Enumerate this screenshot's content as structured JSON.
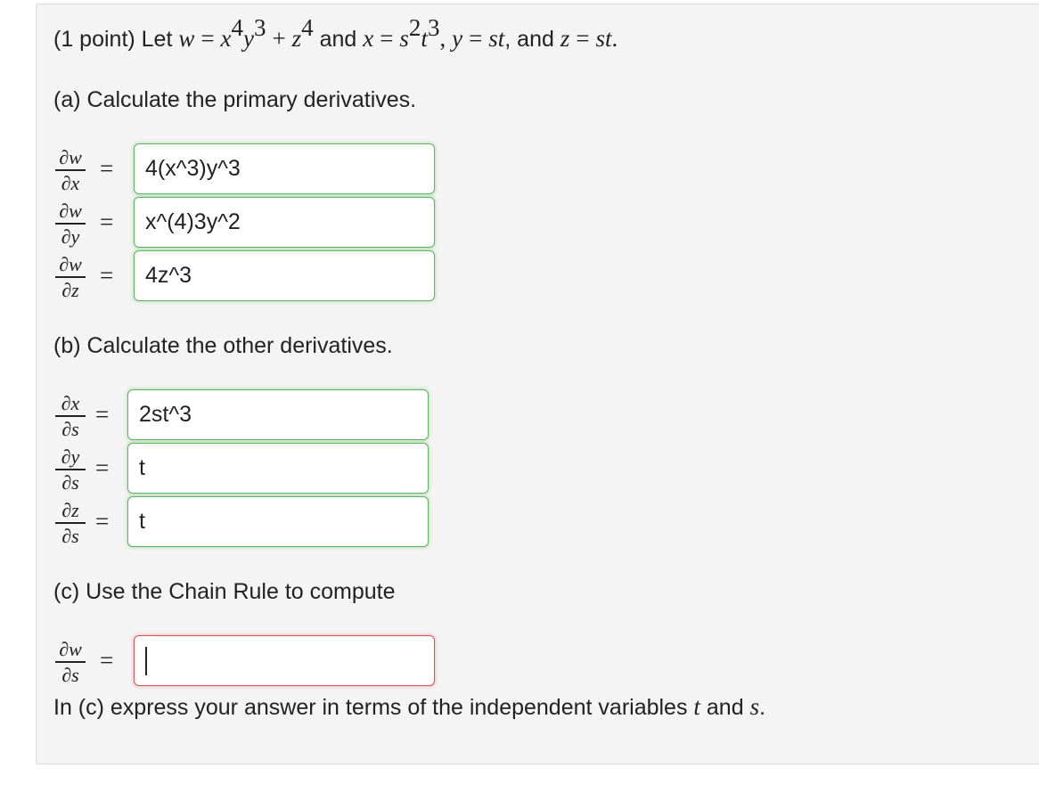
{
  "intro": {
    "points": "(1 point) Let",
    "w": "w",
    "eq": "=",
    "x": "x",
    "exp4": "4",
    "y": "y",
    "exp3": "3",
    "plus": "+",
    "z": "z",
    "zexp": "4",
    "and": "and",
    "x2": "x",
    "s": "s",
    "sexp": "2",
    "t": "t",
    "texp": "3",
    "comma": ",",
    "y2": "y",
    "st": "st",
    "and2": ", and",
    "z2": "z",
    "st2": "st",
    "period": "."
  },
  "part_a": {
    "heading": "(a) Calculate the primary derivatives.",
    "rows": [
      {
        "num": "∂w",
        "den": "∂x",
        "eq": "=",
        "value": "4(x^3)y^3"
      },
      {
        "num": "∂w",
        "den": "∂y",
        "eq": "=",
        "value": "x^(4)3y^2"
      },
      {
        "num": "∂w",
        "den": "∂z",
        "eq": "=",
        "value": "4z^3"
      }
    ]
  },
  "part_b": {
    "heading": "(b) Calculate the other derivatives.",
    "rows": [
      {
        "num": "∂x",
        "den": "∂s",
        "eq": "=",
        "value": "2st^3"
      },
      {
        "num": "∂y",
        "den": "∂s",
        "eq": "=",
        "value": "t"
      },
      {
        "num": "∂z",
        "den": "∂s",
        "eq": "=",
        "value": "t"
      }
    ]
  },
  "part_c": {
    "heading": "(c) Use the Chain Rule to compute",
    "row": {
      "num": "∂w",
      "den": "∂s",
      "eq": "=",
      "value": ""
    },
    "note_prefix": "In (c) express your answer in terms of the independent variables",
    "note_t": "t",
    "note_and": "and",
    "note_s": "s",
    "note_period": "."
  },
  "colors": {
    "correct_border": "#5cb85c",
    "incorrect_border": "#d9534f",
    "panel_bg": "#f4f4f4"
  }
}
